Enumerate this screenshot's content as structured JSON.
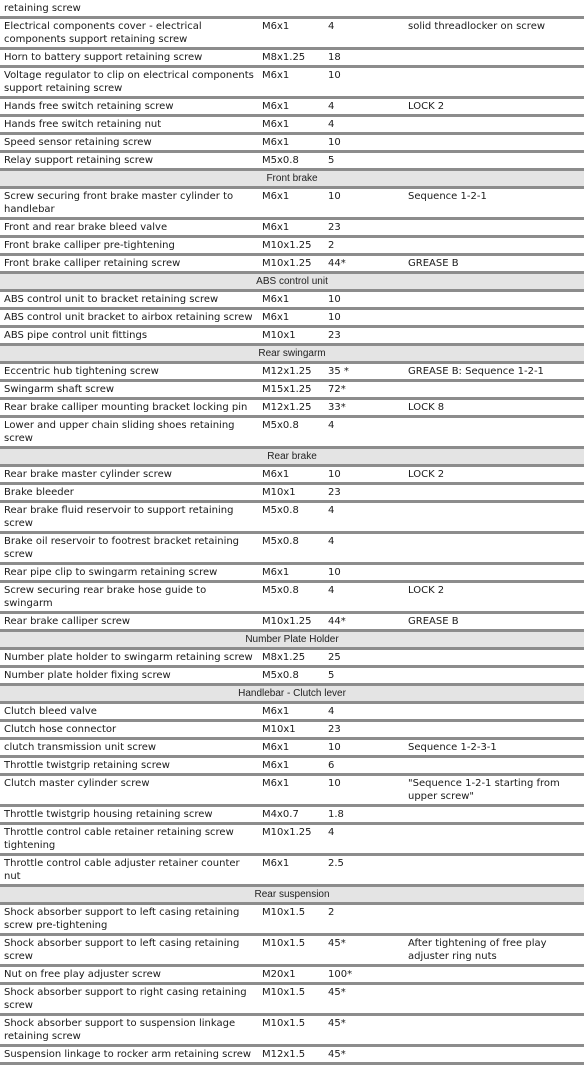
{
  "continuation_text": "retaining screw",
  "sections": [
    {
      "title": null,
      "rows": [
        {
          "description": "Electrical components cover - electrical components support retaining screw",
          "thread": "M6x1",
          "torque": "4",
          "notes": "solid threadlocker on screw"
        },
        {
          "description": "Horn to battery support retaining screw",
          "thread": "M8x1.25",
          "torque": "18",
          "notes": ""
        },
        {
          "description": "Voltage regulator to clip on electrical components support retaining screw",
          "thread": "M6x1",
          "torque": "10",
          "notes": ""
        },
        {
          "description": "Hands free switch retaining screw",
          "thread": "M6x1",
          "torque": "4",
          "notes": "LOCK 2"
        },
        {
          "description": "Hands free switch retaining nut",
          "thread": "M6x1",
          "torque": "4",
          "notes": ""
        },
        {
          "description": "Speed sensor retaining screw",
          "thread": "M6x1",
          "torque": "10",
          "notes": ""
        },
        {
          "description": "Relay support retaining screw",
          "thread": "M5x0.8",
          "torque": "5",
          "notes": ""
        }
      ]
    },
    {
      "title": "Front brake",
      "rows": [
        {
          "description": "Screw securing front brake master cylinder to handlebar",
          "thread": "M6x1",
          "torque": "10",
          "notes": "Sequence 1-2-1"
        },
        {
          "description": "Front and rear brake bleed valve",
          "thread": "M6x1",
          "torque": "23",
          "notes": ""
        },
        {
          "description": "Front brake calliper pre-tightening",
          "thread": "M10x1.25",
          "torque": "2",
          "notes": ""
        },
        {
          "description": "Front brake calliper retaining screw",
          "thread": "M10x1.25",
          "torque": "44*",
          "notes": "GREASE B"
        }
      ]
    },
    {
      "title": "ABS control unit",
      "rows": [
        {
          "description": "ABS control unit to bracket retaining screw",
          "thread": "M6x1",
          "torque": "10",
          "notes": ""
        },
        {
          "description": "ABS control unit bracket to airbox retaining screw",
          "thread": "M6x1",
          "torque": "10",
          "notes": ""
        },
        {
          "description": "ABS pipe control unit fittings",
          "thread": "M10x1",
          "torque": "23",
          "notes": ""
        }
      ]
    },
    {
      "title": "Rear swingarm",
      "rows": [
        {
          "description": "Eccentric hub tightening screw",
          "thread": "M12x1.25",
          "torque": "35 *",
          "notes": "GREASE B: Sequence 1-2-1"
        },
        {
          "description": "Swingarm shaft screw",
          "thread": "M15x1.25",
          "torque": "72*",
          "notes": ""
        },
        {
          "description": "Rear brake calliper mounting bracket locking pin",
          "thread": "M12x1.25",
          "torque": "33*",
          "notes": "LOCK 8"
        },
        {
          "description": "Lower and upper chain sliding shoes retaining screw",
          "thread": "M5x0.8",
          "torque": "4",
          "notes": ""
        }
      ]
    },
    {
      "title": "Rear brake",
      "rows": [
        {
          "description": "Rear brake master cylinder screw",
          "thread": "M6x1",
          "torque": "10",
          "notes": "LOCK 2"
        },
        {
          "description": "Brake bleeder",
          "thread": "M10x1",
          "torque": "23",
          "notes": ""
        },
        {
          "description": "Rear brake fluid reservoir to support retaining screw",
          "thread": "M5x0.8",
          "torque": "4",
          "notes": ""
        },
        {
          "description": "Brake oil reservoir to footrest bracket retaining screw",
          "thread": "M5x0.8",
          "torque": "4",
          "notes": ""
        },
        {
          "description": "Rear pipe clip to swingarm retaining screw",
          "thread": "M6x1",
          "torque": "10",
          "notes": ""
        },
        {
          "description": "Screw securing rear brake hose guide to swingarm",
          "thread": "M5x0.8",
          "torque": "4",
          "notes": "LOCK 2"
        },
        {
          "description": "Rear brake calliper screw",
          "thread": "M10x1.25",
          "torque": "44*",
          "notes": "GREASE B"
        }
      ]
    },
    {
      "title": "Number Plate Holder",
      "rows": [
        {
          "description": "Number plate holder to swingarm retaining screw",
          "thread": "M8x1.25",
          "torque": "25",
          "notes": ""
        },
        {
          "description": "Number plate holder fixing screw",
          "thread": "M5x0.8",
          "torque": "5",
          "notes": ""
        }
      ]
    },
    {
      "title": "Handlebar - Clutch lever",
      "rows": [
        {
          "description": "Clutch bleed valve",
          "thread": "M6x1",
          "torque": "4",
          "notes": ""
        },
        {
          "description": "Clutch hose connector",
          "thread": "M10x1",
          "torque": "23",
          "notes": ""
        },
        {
          "description": "clutch transmission unit screw",
          "thread": "M6x1",
          "torque": "10",
          "notes": "Sequence 1-2-3-1"
        },
        {
          "description": "Throttle twistgrip retaining screw",
          "thread": "M6x1",
          "torque": "6",
          "notes": ""
        },
        {
          "description": "Clutch master cylinder screw",
          "thread": "M6x1",
          "torque": "10",
          "notes": "\"Sequence 1-2-1 starting from upper screw\""
        },
        {
          "description": "Throttle twistgrip housing retaining screw",
          "thread": "M4x0.7",
          "torque": "1.8",
          "notes": ""
        },
        {
          "description": "Throttle control cable retainer retaining screw tightening",
          "thread": "M10x1.25",
          "torque": "4",
          "notes": ""
        },
        {
          "description": "Throttle control cable adjuster retainer counter nut",
          "thread": "M6x1",
          "torque": "2.5",
          "notes": ""
        }
      ]
    },
    {
      "title": "Rear suspension",
      "rows": [
        {
          "description": "Shock absorber support to left casing retaining screw pre-tightening",
          "thread": "M10x1.5",
          "torque": "2",
          "notes": ""
        },
        {
          "description": "Shock absorber support to left casing retaining screw",
          "thread": "M10x1.5",
          "torque": "45*",
          "notes": "After tightening of free play adjuster ring nuts"
        },
        {
          "description": "Nut on free play adjuster screw",
          "thread": "M20x1",
          "torque": "100*",
          "notes": ""
        },
        {
          "description": "Shock absorber support to right casing retaining screw",
          "thread": "M10x1.5",
          "torque": "45*",
          "notes": ""
        },
        {
          "description": "Shock absorber support to suspension linkage retaining screw",
          "thread": "M10x1.5",
          "torque": "45*",
          "notes": ""
        },
        {
          "description": "Suspension linkage to rocker arm retaining screw",
          "thread": "M12x1.5",
          "torque": "45*",
          "notes": ""
        }
      ]
    }
  ]
}
